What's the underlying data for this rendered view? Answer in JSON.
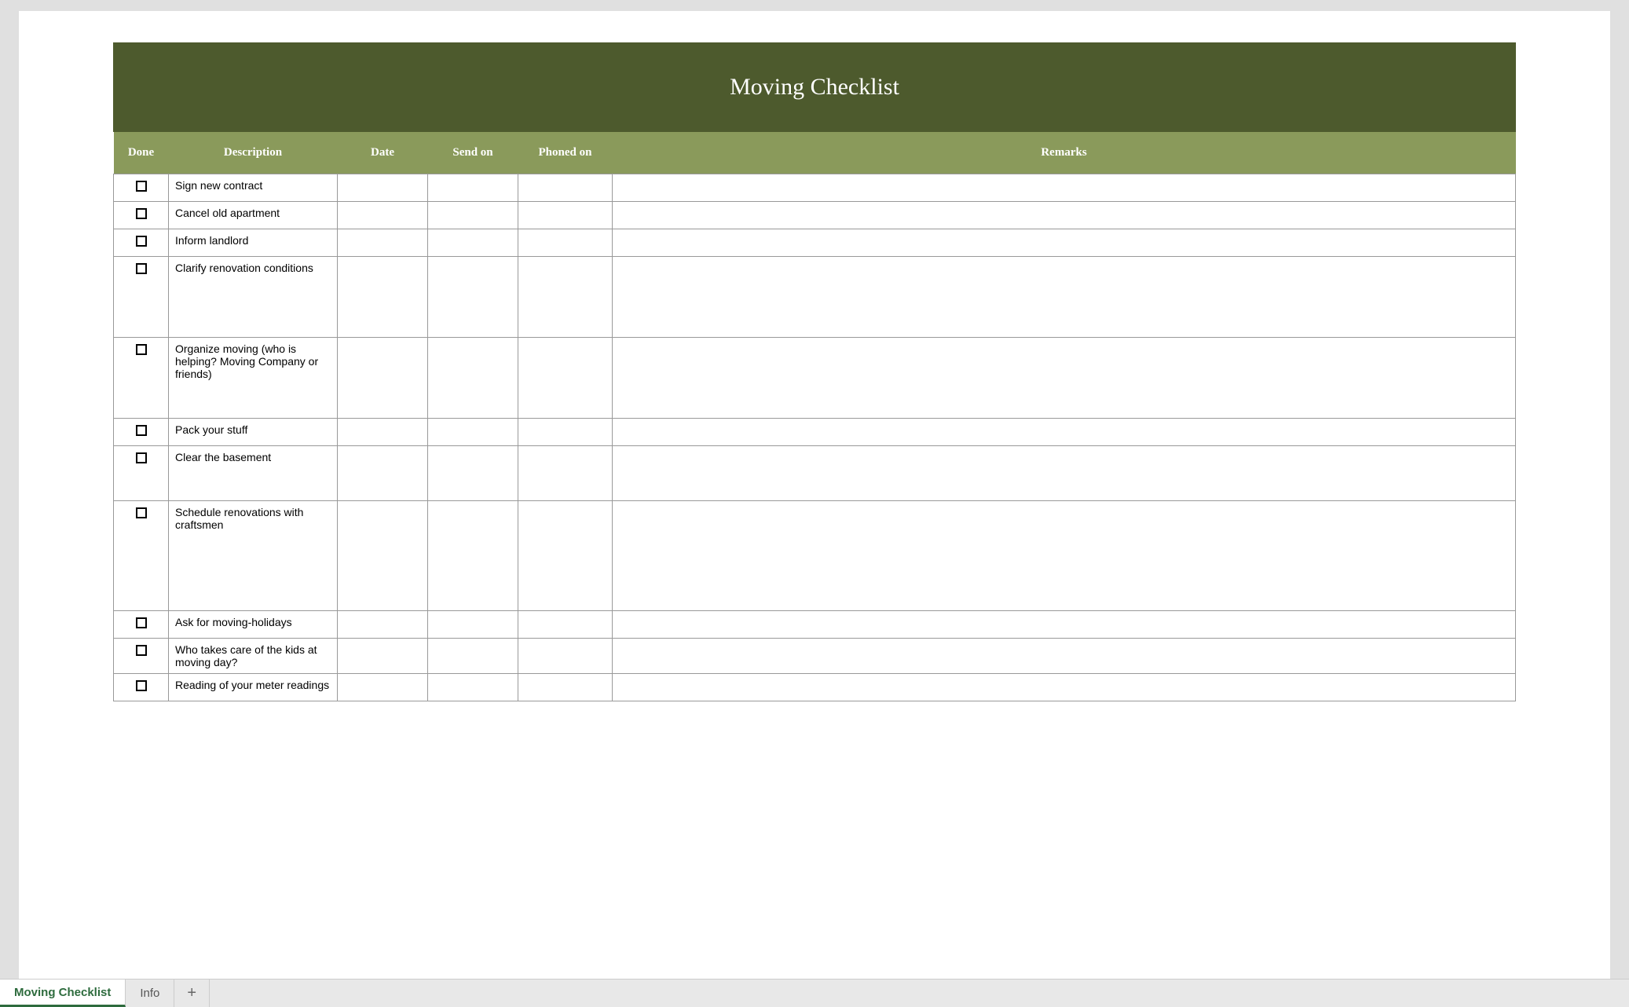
{
  "title": "Moving Checklist",
  "columns": {
    "done": "Done",
    "description": "Description",
    "date": "Date",
    "sendon": "Send on",
    "phonedon": "Phoned on",
    "remarks": "Remarks"
  },
  "rows": [
    {
      "description": "Sign new contract",
      "date": "",
      "sendon": "",
      "phonedon": "",
      "remarks": "",
      "height": "normal"
    },
    {
      "description": "Cancel old apartment",
      "date": "",
      "sendon": "",
      "phonedon": "",
      "remarks": "",
      "height": "normal"
    },
    {
      "description": "Inform landlord",
      "date": "",
      "sendon": "",
      "phonedon": "",
      "remarks": "",
      "height": "normal"
    },
    {
      "description": "Clarify renovation conditions",
      "date": "",
      "sendon": "",
      "phonedon": "",
      "remarks": "",
      "height": "tall"
    },
    {
      "description": "Organize moving (who is helping? Moving Company or friends)",
      "date": "",
      "sendon": "",
      "phonedon": "",
      "remarks": "",
      "height": "tall"
    },
    {
      "description": "Pack your stuff",
      "date": "",
      "sendon": "",
      "phonedon": "",
      "remarks": "",
      "height": "normal"
    },
    {
      "description": "Clear the basement",
      "date": "",
      "sendon": "",
      "phonedon": "",
      "remarks": "",
      "height": "medium"
    },
    {
      "description": "Schedule renovations with craftsmen",
      "date": "",
      "sendon": "",
      "phonedon": "",
      "remarks": "",
      "height": "xtall"
    },
    {
      "description": "Ask for moving-holidays",
      "date": "",
      "sendon": "",
      "phonedon": "",
      "remarks": "",
      "height": "normal"
    },
    {
      "description": "Who takes care of the kids at moving day?",
      "date": "",
      "sendon": "",
      "phonedon": "",
      "remarks": "",
      "height": "normal"
    },
    {
      "description": "Reading of your meter readings",
      "date": "",
      "sendon": "",
      "phonedon": "",
      "remarks": "",
      "height": "normal"
    }
  ],
  "tabs": [
    {
      "label": "Moving Checklist",
      "active": true
    },
    {
      "label": "Info",
      "active": false
    }
  ],
  "addTabLabel": "+"
}
